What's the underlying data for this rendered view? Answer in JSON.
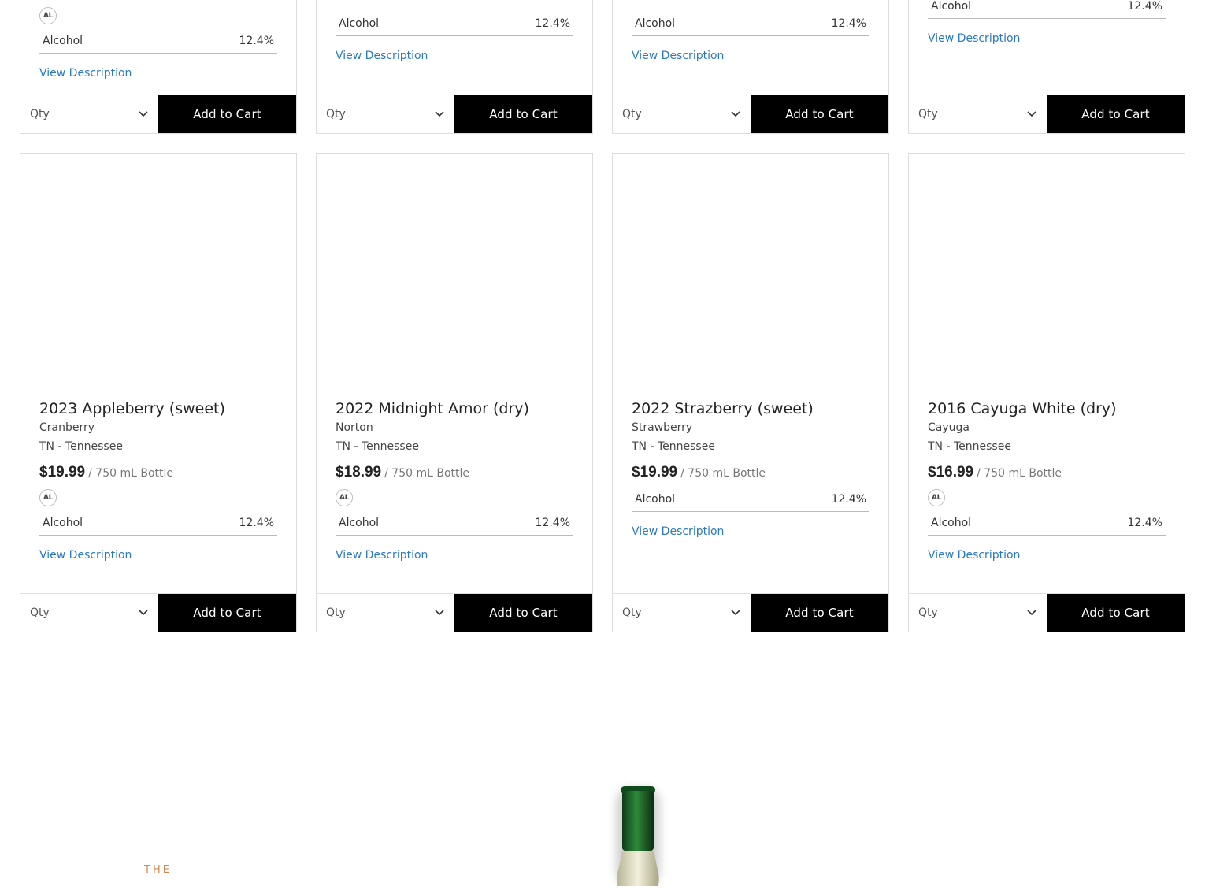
{
  "top_row": [
    {
      "attr_label": "Alcohol",
      "attr_value": "12.4%",
      "link": "View Description",
      "qty": "Qty",
      "cart": "Add to Cart",
      "has_badge": true
    },
    {
      "attr_label": "Alcohol",
      "attr_value": "12.4%",
      "link": "View Description",
      "qty": "Qty",
      "cart": "Add to Cart"
    },
    {
      "attr_label": "Alcohol",
      "attr_value": "12.4%",
      "link": "View Description",
      "qty": "Qty",
      "cart": "Add to Cart"
    },
    {
      "attr_label": "Alcohol",
      "attr_value": "12.4%",
      "link": "View Description",
      "qty": "Qty",
      "cart": "Add to Cart"
    }
  ],
  "products": [
    {
      "title": "2023 Appleberry (sweet)",
      "varietal": "Cranberry",
      "region": "TN - Tennessee",
      "price": "$19.99",
      "unit": "/ 750 mL Bottle",
      "badge": "AL",
      "attr_label": "Alcohol",
      "attr_value": "12.4%",
      "link": "View Description",
      "qty": "Qty",
      "cart": "Add to Cart"
    },
    {
      "title": "2022 Midnight Amor (dry)",
      "varietal": "Norton",
      "region": "TN - Tennessee",
      "price": "$18.99",
      "unit": "/ 750 mL Bottle",
      "badge": "AL",
      "attr_label": "Alcohol",
      "attr_value": "12.4%",
      "link": "View Description",
      "qty": "Qty",
      "cart": "Add to Cart"
    },
    {
      "title": "2022 Strazberry (sweet)",
      "varietal": "Strawberry",
      "region": "TN - Tennessee",
      "price": "$19.99",
      "unit": "/ 750 mL Bottle",
      "attr_label": "Alcohol",
      "attr_value": "12.4%",
      "link": "View Description",
      "qty": "Qty",
      "cart": "Add to Cart"
    },
    {
      "title": "2016 Cayuga White (dry)",
      "varietal": "Cayuga",
      "region": "TN - Tennessee",
      "price": "$16.99",
      "unit": "/ 750 mL Bottle",
      "badge": "AL",
      "attr_label": "Alcohol",
      "attr_value": "12.4%",
      "link": "View Description",
      "qty": "Qty",
      "cart": "Add to Cart"
    }
  ],
  "top_badge": "AL",
  "promo": {
    "eyebrow": "THE"
  },
  "colors": {
    "link": "#2a7ac0",
    "button": "#000000",
    "accent": "#d4884c"
  }
}
